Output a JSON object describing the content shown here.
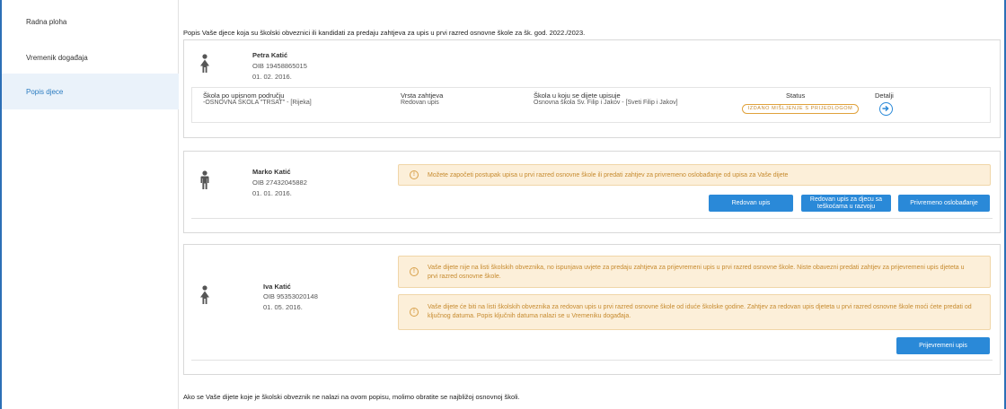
{
  "sidebar": {
    "items": [
      {
        "label": "Radna ploha",
        "active": false
      },
      {
        "label": "Vremenik događaja",
        "active": false
      },
      {
        "label": "Popis djece",
        "active": true
      }
    ]
  },
  "main": {
    "intro": "Popis Vaše djece koja su školski obveznici ili kandidati za predaju zahtjeva za upis u prvi razred osnovne škole za šk. god. 2022./2023.",
    "footer_note": "Ako se Vaše dijete koje je školski obveznik ne nalazi na ovom popisu, molimo obratite se najbližoj osnovnoj školi."
  },
  "children": [
    {
      "name": "Petra Katić",
      "oib": "OIB 19458865015",
      "dob": "01. 02. 2016.",
      "icon": "girl-icon",
      "application": {
        "headers": {
          "school_area": "Škola po upisnom području",
          "request_type": "Vrsta zahtjeva",
          "school_enrolled": "Škola u koju se dijete upisuje",
          "status": "Status",
          "details": "Detalji"
        },
        "school_area": "-OSNOVNA ŠKOLA \"TRSAT\" - [Rijeka]",
        "request_type": "Redovan upis",
        "school_enrolled": "Osnovna škola Sv. Filip i Jakov - [Sveti Filip i Jakov]",
        "status": "IZDANO MIŠLJENJE S PRIJEDLOGOM"
      }
    },
    {
      "name": "Marko Katić",
      "oib": "OIB 27432045882",
      "dob": "01. 01. 2016.",
      "icon": "boy-icon",
      "alert": "Možete započeti postupak upisa u prvi razred osnovne škole ili predati zahtjev za privremeno oslobađanje od upisa za Vaše dijete",
      "buttons": {
        "regular": "Redovan upis",
        "special": "Redovan upis za djecu sa teškoćama u razvoju",
        "exemption": "Privremeno oslobađanje"
      }
    },
    {
      "name": "Iva Katić",
      "oib": "OIB 95353020148",
      "dob": "01. 05. 2016.",
      "icon": "girl-icon",
      "alert1": "Vaše dijete nije na listi školskih obveznika, no ispunjava uvjete za predaju zahtjeva za prijevremeni upis u prvi razred osnovne škole. Niste obavezni predati zahtjev za prijevremeni upis djeteta u prvi razred osnovne škole.",
      "alert2": "Vaše dijete će biti na listi školskih obveznika za redovan upis u prvi razred osnovne škole od idućе školske godine. Zahtjev za redovan upis djeteta u prvi razred osnovne škole moći ćete predati od ključnog datuma. Popis ključnih datuma nalazi se u Vremeniku događaja.",
      "buttons": {
        "early": "Prijevremeni upis"
      }
    }
  ],
  "colors": {
    "accent": "#2a89d8",
    "active_bg": "#eaf2fa",
    "warning_bg": "#fcefd9",
    "warning_text": "#c68a2e",
    "frame": "#2c6fb6"
  }
}
